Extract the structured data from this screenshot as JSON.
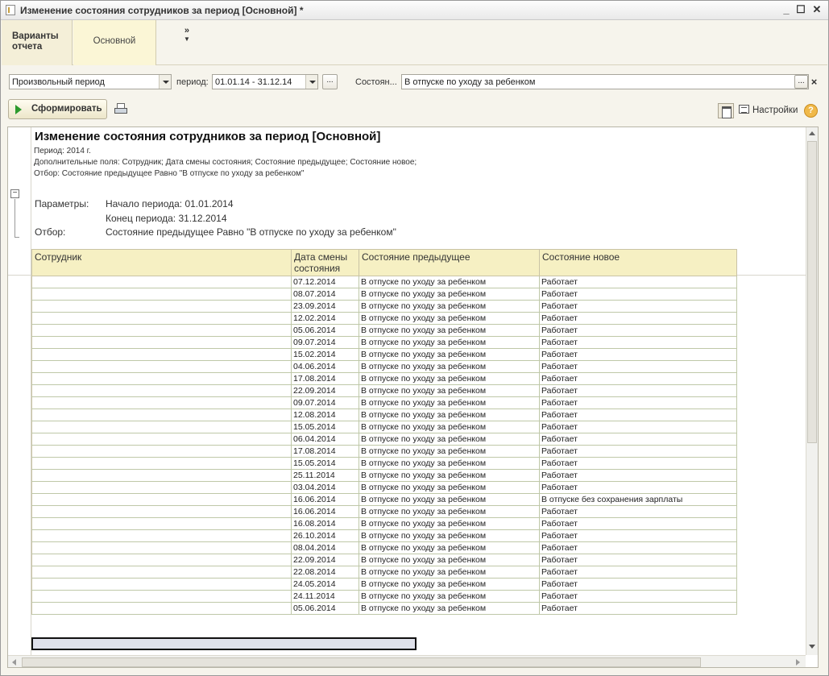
{
  "window": {
    "title": "Изменение состояния сотрудников за период [Основной] *",
    "minimize": "_",
    "maximize": "☐",
    "close": "✕"
  },
  "variants": {
    "label": "Варианты отчета",
    "active_tab": "Основной",
    "more": "»"
  },
  "filters": {
    "period_type": "Произвольный период",
    "period_label": "период:",
    "period_value": "01.01.14 - 31.12.14",
    "ellipsis": "...",
    "state_label": "Состоян...",
    "state_value": "В отпуске по уходу за ребенком",
    "state_clear": "×"
  },
  "toolbar": {
    "generate_label": "Сформировать",
    "settings_label": "Настройки",
    "help": "?"
  },
  "report": {
    "title": "Изменение состояния сотрудников за период [Основной]",
    "period_line": "Период: 2014 г.",
    "extra_fields_line": "Дополнительные поля: Сотрудник; Дата смены состояния; Состояние предыдущее; Состояние новое;",
    "filter_line": "Отбор: Состояние предыдущее Равно \"В отпуске по уходу за ребенком\"",
    "params_label": "Параметры:",
    "period_start": "Начало периода: 01.01.2014",
    "period_end": "Конец периода: 31.12.2014",
    "filter_label": "Отбор:",
    "filter_value": "Состояние предыдущее Равно \"В отпуске по уходу за ребенком\"",
    "columns": [
      "Сотрудник",
      "Дата смены состояния",
      "Состояние предыдущее",
      "Состояние новое"
    ],
    "rows": [
      {
        "employee": "",
        "date": "07.12.2014",
        "prev": "В отпуске по уходу за ребенком",
        "new": "Работает"
      },
      {
        "employee": "",
        "date": "08.07.2014",
        "prev": "В отпуске по уходу за ребенком",
        "new": "Работает"
      },
      {
        "employee": "",
        "date": "23.09.2014",
        "prev": "В отпуске по уходу за ребенком",
        "new": "Работает"
      },
      {
        "employee": "",
        "date": "12.02.2014",
        "prev": "В отпуске по уходу за ребенком",
        "new": "Работает"
      },
      {
        "employee": "",
        "date": "05.06.2014",
        "prev": "В отпуске по уходу за ребенком",
        "new": "Работает"
      },
      {
        "employee": "",
        "date": "09.07.2014",
        "prev": "В отпуске по уходу за ребенком",
        "new": "Работает"
      },
      {
        "employee": "",
        "date": "15.02.2014",
        "prev": "В отпуске по уходу за ребенком",
        "new": "Работает"
      },
      {
        "employee": "",
        "date": "04.06.2014",
        "prev": "В отпуске по уходу за ребенком",
        "new": "Работает"
      },
      {
        "employee": "",
        "date": "17.08.2014",
        "prev": "В отпуске по уходу за ребенком",
        "new": "Работает"
      },
      {
        "employee": "",
        "date": "22.09.2014",
        "prev": "В отпуске по уходу за ребенком",
        "new": "Работает"
      },
      {
        "employee": "",
        "date": "09.07.2014",
        "prev": "В отпуске по уходу за ребенком",
        "new": "Работает"
      },
      {
        "employee": "",
        "date": "12.08.2014",
        "prev": "В отпуске по уходу за ребенком",
        "new": "Работает"
      },
      {
        "employee": "",
        "date": "15.05.2014",
        "prev": "В отпуске по уходу за ребенком",
        "new": "Работает"
      },
      {
        "employee": "",
        "date": "06.04.2014",
        "prev": "В отпуске по уходу за ребенком",
        "new": "Работает"
      },
      {
        "employee": "",
        "date": "17.08.2014",
        "prev": "В отпуске по уходу за ребенком",
        "new": "Работает"
      },
      {
        "employee": "",
        "date": "15.05.2014",
        "prev": "В отпуске по уходу за ребенком",
        "new": "Работает"
      },
      {
        "employee": "",
        "date": "25.11.2014",
        "prev": "В отпуске по уходу за ребенком",
        "new": "Работает"
      },
      {
        "employee": "",
        "date": "03.04.2014",
        "prev": "В отпуске по уходу за ребенком",
        "new": "Работает"
      },
      {
        "employee": "",
        "date": "16.06.2014",
        "prev": "В отпуске по уходу за ребенком",
        "new": "В отпуске без сохранения зарплаты"
      },
      {
        "employee": "",
        "date": "16.06.2014",
        "prev": "В отпуске по уходу за ребенком",
        "new": "Работает"
      },
      {
        "employee": "",
        "date": "16.08.2014",
        "prev": "В отпуске по уходу за ребенком",
        "new": "Работает"
      },
      {
        "employee": "",
        "date": "26.10.2014",
        "prev": "В отпуске по уходу за ребенком",
        "new": "Работает"
      },
      {
        "employee": "",
        "date": "08.04.2014",
        "prev": "В отпуске по уходу за ребенком",
        "new": "Работает"
      },
      {
        "employee": "",
        "date": "22.09.2014",
        "prev": "В отпуске по уходу за ребенком",
        "new": "Работает"
      },
      {
        "employee": "",
        "date": "22.08.2014",
        "prev": "В отпуске по уходу за ребенком",
        "new": "Работает"
      },
      {
        "employee": "",
        "date": "24.05.2014",
        "prev": "В отпуске по уходу за ребенком",
        "new": "Работает"
      },
      {
        "employee": "",
        "date": "24.11.2014",
        "prev": "В отпуске по уходу за ребенком",
        "new": "Работает"
      },
      {
        "employee": "",
        "date": "05.06.2014",
        "prev": "В отпуске по уходу за ребенком",
        "new": "Работает"
      }
    ]
  },
  "colors": {
    "header_fill": "#f6f0c3",
    "tab_fill": "#fbf6d6",
    "accent_green": "#2d9a2d"
  },
  "icons": [
    "app-icon",
    "minimize-icon",
    "maximize-icon",
    "close-icon",
    "more-chevron-icon",
    "dropdown-arrow-icon",
    "play-icon",
    "print-preview-icon",
    "layout-icon",
    "settings-icon",
    "help-icon",
    "collapse-icon"
  ]
}
